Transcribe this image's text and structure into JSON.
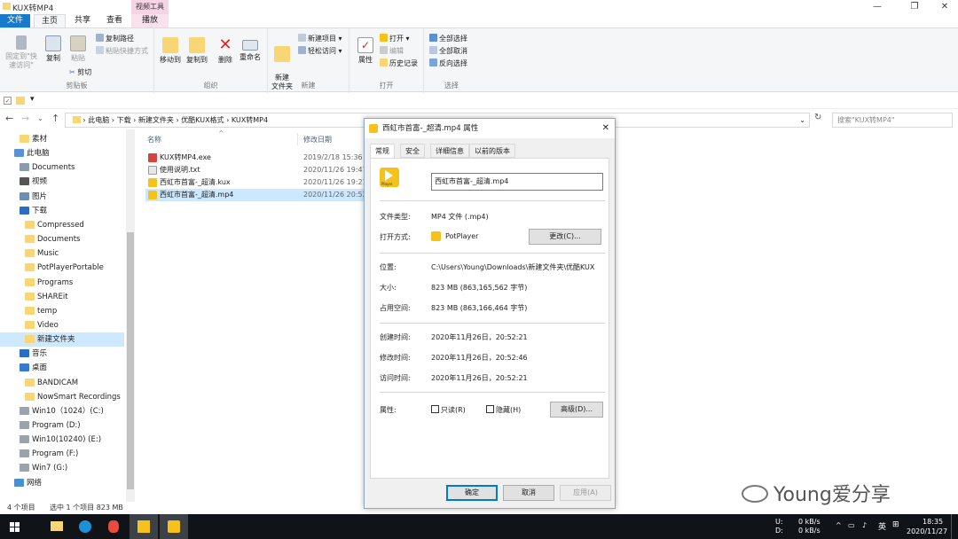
{
  "window": {
    "title": "KUX转MP4"
  },
  "tabs": {
    "file": "文件",
    "home": "主页",
    "share": "共享",
    "view": "查看",
    "context_header": "视频工具",
    "play": "播放"
  },
  "ribbon": {
    "clipboard": {
      "pin": "固定到\"快速访问\"",
      "copy": "复制",
      "paste": "粘贴",
      "copy_path": "复制路径",
      "paste_shortcut": "粘贴快捷方式",
      "cut": "剪切",
      "label": "剪贴板"
    },
    "organize": {
      "move_to": "移动到",
      "copy_to": "复制到",
      "delete": "删除",
      "rename": "重命名",
      "label": "组织"
    },
    "new": {
      "new_folder": "新建\n文件夹",
      "new_item": "新建项目",
      "easy_access": "轻松访问",
      "label": "新建"
    },
    "open": {
      "properties": "属性",
      "open": "打开",
      "edit": "编辑",
      "history": "历史记录",
      "label": "打开"
    },
    "select": {
      "select_all": "全部选择",
      "select_none": "全部取消",
      "invert": "反向选择",
      "label": "选择"
    }
  },
  "address": {
    "crumbs": [
      "此电脑",
      "下载",
      "新建文件夹",
      "优酷KUX格式",
      "KUX转MP4"
    ],
    "search_placeholder": "搜索\"KUX转MP4\""
  },
  "nav": {
    "items": [
      {
        "label": "素材",
        "indent": 1
      },
      {
        "label": "此电脑",
        "indent": 0
      },
      {
        "label": "Documents",
        "indent": 1
      },
      {
        "label": "视频",
        "indent": 1
      },
      {
        "label": "图片",
        "indent": 1
      },
      {
        "label": "下载",
        "indent": 1
      },
      {
        "label": "Compressed",
        "indent": 2
      },
      {
        "label": "Documents",
        "indent": 2
      },
      {
        "label": "Music",
        "indent": 2
      },
      {
        "label": "PotPlayerPortable",
        "indent": 2
      },
      {
        "label": "Programs",
        "indent": 2
      },
      {
        "label": "SHAREit",
        "indent": 2
      },
      {
        "label": "temp",
        "indent": 2
      },
      {
        "label": "Video",
        "indent": 2
      },
      {
        "label": "新建文件夹",
        "indent": 2
      },
      {
        "label": "音乐",
        "indent": 1
      },
      {
        "label": "桌面",
        "indent": 1
      },
      {
        "label": "BANDICAM",
        "indent": 2
      },
      {
        "label": "NowSmart Recordings",
        "indent": 2
      },
      {
        "label": "Win10（1024）(C:)",
        "indent": 1
      },
      {
        "label": "Program (D:)",
        "indent": 1
      },
      {
        "label": "Win10(10240) (E:)",
        "indent": 1
      },
      {
        "label": "Program (F:)",
        "indent": 1
      },
      {
        "label": "Win7 (G:)",
        "indent": 1
      },
      {
        "label": "网络",
        "indent": 0
      }
    ]
  },
  "files": {
    "col_name": "名称",
    "col_date": "修改日期",
    "rows": [
      {
        "name": "KUX转MP4.exe",
        "date": "2019/2/18 15:36",
        "icon": "#d9443a"
      },
      {
        "name": "使用说明.txt",
        "date": "2020/11/26 19:47",
        "icon": "#e8e8e8"
      },
      {
        "name": "西虹市首富-_超清.kux",
        "date": "2020/11/26 19:21",
        "icon": "#f4c21a"
      },
      {
        "name": "西虹市首富-_超清.mp4",
        "date": "2020/11/26 20:52",
        "icon": "#f4c21a"
      }
    ]
  },
  "status": {
    "count": "4 个项目",
    "selected": "选中 1 个项目  823 MB"
  },
  "dialog": {
    "title": "西虹市首富-_超清.mp4 属性",
    "tabs": [
      "常规",
      "安全",
      "详细信息",
      "以前的版本"
    ],
    "filename": "西虹市首富-_超清.mp4",
    "icon_text": "Player",
    "type_label": "文件类型:",
    "type_value": "MP4 文件 (.mp4)",
    "open_label": "打开方式:",
    "open_value": "PotPlayer",
    "change_btn": "更改(C)...",
    "loc_label": "位置:",
    "loc_value": "C:\\Users\\Young\\Downloads\\新建文件夹\\优酷KUX",
    "size_label": "大小:",
    "size_value": "823 MB (863,165,562 字节)",
    "disk_label": "占用空间:",
    "disk_value": "823 MB (863,166,464 字节)",
    "created_label": "创建时间:",
    "created_value": "2020年11月26日，20:52:21",
    "modified_label": "修改时间:",
    "modified_value": "2020年11月26日，20:52:46",
    "accessed_label": "访问时间:",
    "accessed_value": "2020年11月26日，20:52:21",
    "attr_label": "属性:",
    "readonly": "只读(R)",
    "hidden": "隐藏(H)",
    "advanced": "高级(D)...",
    "ok": "确定",
    "cancel": "取消",
    "apply": "应用(A)"
  },
  "taskbar": {
    "net_up": "0 kB/s",
    "net_down": "0 kB/s",
    "net_u": "U:",
    "net_d": "D:",
    "ime": "英",
    "time": "18:35",
    "date": "2020/11/27"
  },
  "watermark": "Young爱分享"
}
